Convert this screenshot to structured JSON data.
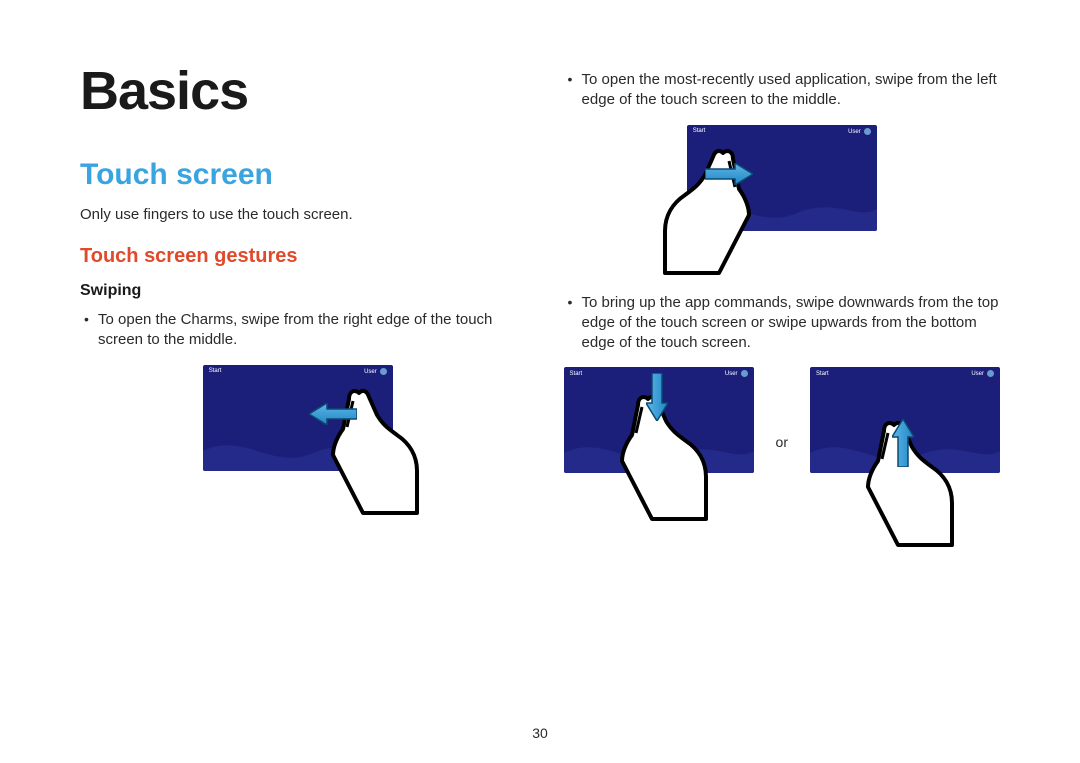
{
  "page_number": "30",
  "left": {
    "title": "Basics",
    "section": "Touch screen",
    "intro": "Only use fingers to use the touch screen.",
    "subsection": "Touch screen gestures",
    "subsub": "Swiping",
    "bullet1": "To open the Charms, swipe from the right edge of the touch screen to the middle."
  },
  "right": {
    "bullet1": "To open the most-recently used application, swipe from the left edge of the touch screen to the middle.",
    "bullet2": "To bring up the app commands, swipe downwards from the top edge of the touch screen or swipe upwards from the bottom edge of the touch screen.",
    "or_label": "or"
  },
  "tablet": {
    "start_label": "Start",
    "user_label": "User"
  }
}
